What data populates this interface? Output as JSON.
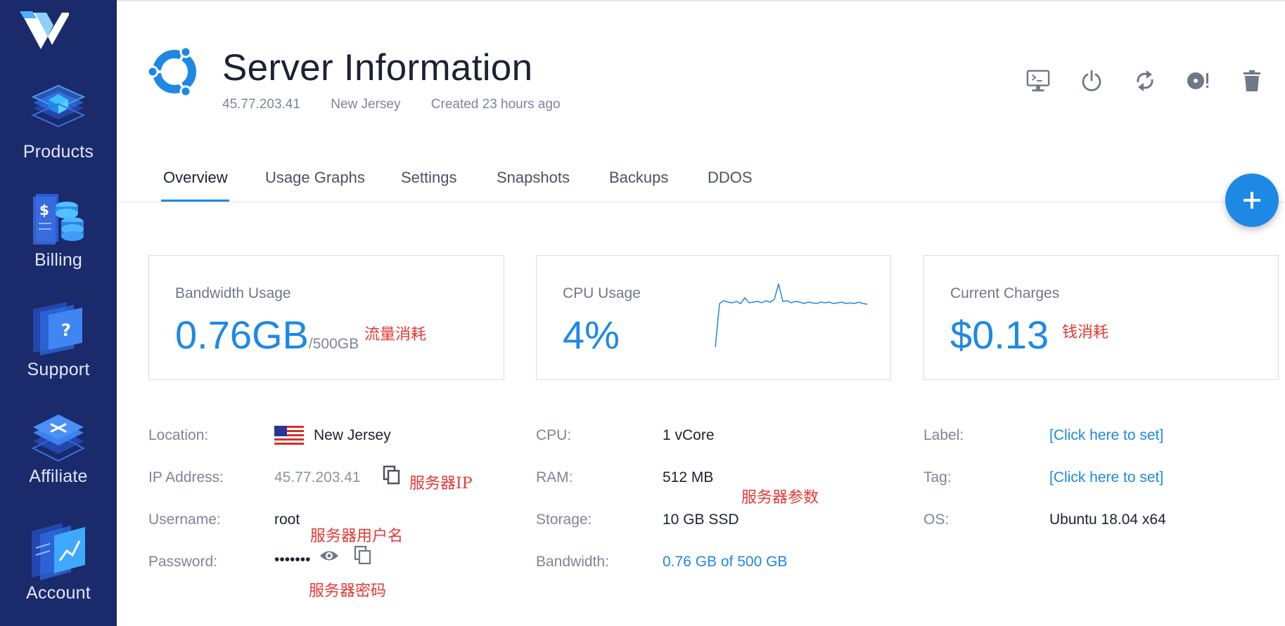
{
  "sidebar": {
    "items": [
      {
        "label": "Products",
        "icon": "products-icon"
      },
      {
        "label": "Billing",
        "icon": "billing-icon"
      },
      {
        "label": "Support",
        "icon": "support-icon"
      },
      {
        "label": "Affiliate",
        "icon": "affiliate-icon"
      },
      {
        "label": "Account",
        "icon": "account-icon"
      }
    ]
  },
  "header": {
    "title": "Server Information",
    "ip": "45.77.203.41",
    "location": "New Jersey",
    "created": "Created 23 hours ago",
    "actions": [
      "console-icon",
      "power-icon",
      "restart-icon",
      "reinstall-icon",
      "trash-icon"
    ]
  },
  "tabs": [
    "Overview",
    "Usage Graphs",
    "Settings",
    "Snapshots",
    "Backups",
    "DDOS"
  ],
  "cards": {
    "bandwidth": {
      "title": "Bandwidth Usage",
      "value": "0.76GB",
      "unit": "/500GB",
      "note": "流量消耗"
    },
    "cpu": {
      "title": "CPU Usage",
      "value": "4%",
      "sparkline": [
        0,
        62,
        66,
        64,
        63,
        65,
        62,
        70,
        63,
        64,
        65,
        63,
        66,
        64,
        68,
        90,
        65,
        66,
        63,
        65,
        64,
        62,
        64,
        63,
        62,
        64,
        63,
        64,
        62,
        63,
        64,
        62,
        63,
        62,
        64,
        62,
        61
      ]
    },
    "charges": {
      "title": "Current Charges",
      "value": "$0.13",
      "note": "钱消耗"
    }
  },
  "details": {
    "location": {
      "label": "Location:",
      "value": "New Jersey"
    },
    "ip": {
      "label": "IP Address:",
      "value": "45.77.203.41",
      "note": "服务器IP"
    },
    "username": {
      "label": "Username:",
      "value": "root",
      "note": "服务器用户名"
    },
    "password": {
      "label": "Password:",
      "value": "•••••••",
      "note": "服务器密码"
    },
    "cpu": {
      "label": "CPU:",
      "value": "1 vCore"
    },
    "ram": {
      "label": "RAM:",
      "value": "512 MB"
    },
    "storage": {
      "label": "Storage:",
      "value": "10 GB SSD"
    },
    "bandwidth": {
      "label": "Bandwidth:",
      "value": "0.76 GB of 500 GB"
    },
    "params_note": "服务器参数",
    "label": {
      "label": "Label:",
      "value": "[Click here to set]"
    },
    "tag": {
      "label": "Tag:",
      "value": "[Click here to set]"
    },
    "os": {
      "label": "OS:",
      "value": "Ubuntu 18.04 x64"
    }
  },
  "colors": {
    "sidebar": "#1b2a6b",
    "accent": "#1e88e5",
    "note": "#e53935"
  }
}
